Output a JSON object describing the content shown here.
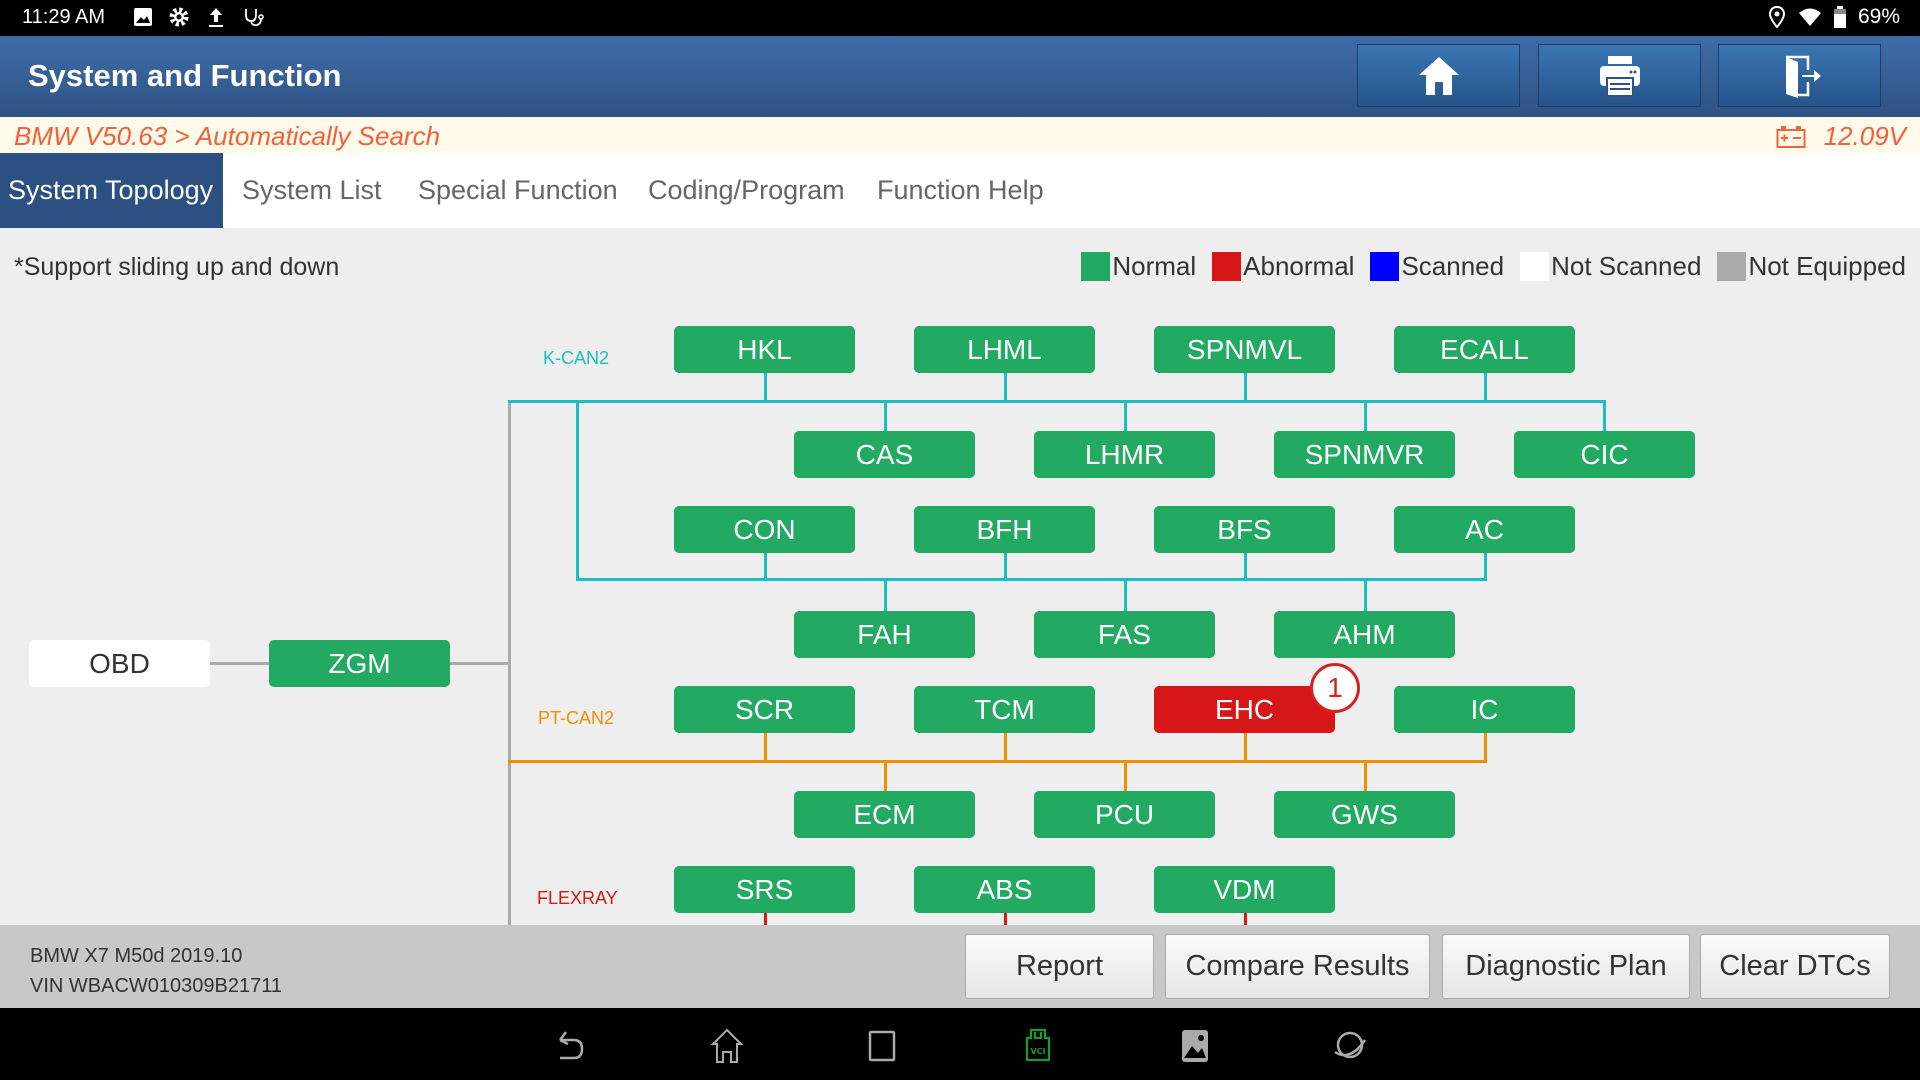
{
  "status_bar": {
    "time": "11:29 AM",
    "left_icons": [
      "gallery-icon",
      "settings-icon",
      "upload-icon",
      "stethoscope-icon"
    ],
    "right_icons": [
      "location-icon",
      "wifi-icon",
      "battery-icon"
    ],
    "battery": "69%"
  },
  "header": {
    "title": "System and Function",
    "buttons": [
      {
        "name": "home",
        "icon": "home-icon"
      },
      {
        "name": "print",
        "icon": "printer-icon"
      },
      {
        "name": "exit",
        "icon": "exit-icon"
      }
    ]
  },
  "breadcrumb": {
    "path": "BMW V50.63 > Automatically Search",
    "voltage": "12.09V"
  },
  "tabs": [
    {
      "label": "System Topology",
      "active": true
    },
    {
      "label": "System List",
      "active": false
    },
    {
      "label": "Special Function",
      "active": false
    },
    {
      "label": "Coding/Program",
      "active": false
    },
    {
      "label": "Function Help",
      "active": false
    }
  ],
  "hint": "*Support sliding up and down",
  "legend": [
    {
      "label": "Normal",
      "color": "#22aa62"
    },
    {
      "label": "Abnormal",
      "color": "#d71717"
    },
    {
      "label": "Scanned",
      "color": "#0000ff"
    },
    {
      "label": "Not Scanned",
      "color": "#ffffff"
    },
    {
      "label": "Not Equipped",
      "color": "#aaaaaa"
    }
  ],
  "colors": {
    "kcan2": "#1bbfc3",
    "ptcan2": "#ef9000",
    "flexray": "#d71717",
    "trunk": "#aaaaaa",
    "normal": "#22aa62",
    "abnormal": "#d71717"
  },
  "topology": {
    "obd": "OBD",
    "gateway": {
      "label": "ZGM",
      "status": "normal"
    },
    "buses": [
      {
        "name": "K-CAN2",
        "color_key": "kcan2",
        "modules": [
          {
            "label": "HKL",
            "status": "normal"
          },
          {
            "label": "LHML",
            "status": "normal"
          },
          {
            "label": "SPNMVL",
            "status": "normal"
          },
          {
            "label": "ECALL",
            "status": "normal"
          },
          {
            "label": "CAS",
            "status": "normal"
          },
          {
            "label": "LHMR",
            "status": "normal"
          },
          {
            "label": "SPNMVR",
            "status": "normal"
          },
          {
            "label": "CIC",
            "status": "normal"
          },
          {
            "label": "CON",
            "status": "normal"
          },
          {
            "label": "BFH",
            "status": "normal"
          },
          {
            "label": "BFS",
            "status": "normal"
          },
          {
            "label": "AC",
            "status": "normal"
          },
          {
            "label": "FAH",
            "status": "normal"
          },
          {
            "label": "FAS",
            "status": "normal"
          },
          {
            "label": "AHM",
            "status": "normal"
          }
        ]
      },
      {
        "name": "PT-CAN2",
        "color_key": "ptcan2",
        "modules": [
          {
            "label": "SCR",
            "status": "normal"
          },
          {
            "label": "TCM",
            "status": "normal"
          },
          {
            "label": "EHC",
            "status": "abnormal",
            "dtc_count": "1"
          },
          {
            "label": "IC",
            "status": "normal"
          },
          {
            "label": "ECM",
            "status": "normal"
          },
          {
            "label": "PCU",
            "status": "normal"
          },
          {
            "label": "GWS",
            "status": "normal"
          }
        ]
      },
      {
        "name": "FLEXRAY",
        "color_key": "flexray",
        "modules": [
          {
            "label": "SRS",
            "status": "normal"
          },
          {
            "label": "ABS",
            "status": "normal"
          },
          {
            "label": "VDM",
            "status": "normal"
          }
        ]
      }
    ]
  },
  "footer": {
    "vehicle": "BMW X7 M50d 2019.10",
    "vin": "VIN WBACW010309B21711",
    "buttons": [
      "Report",
      "Compare Results",
      "Diagnostic Plan",
      "Clear DTCs"
    ]
  },
  "nav_bar": [
    "back-icon",
    "home-icon",
    "recents-icon",
    "vci-icon",
    "gallery-icon",
    "browser-icon"
  ]
}
